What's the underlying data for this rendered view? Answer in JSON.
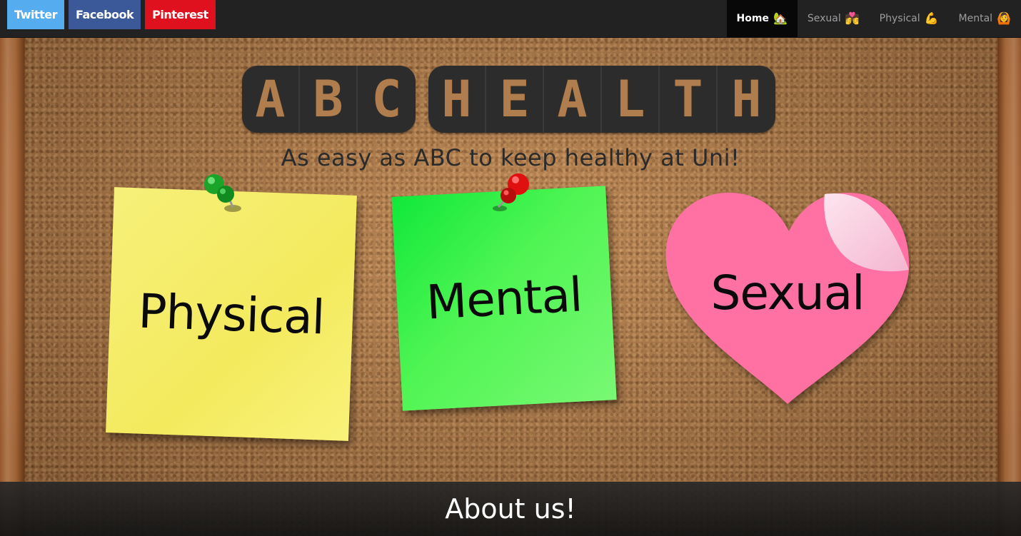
{
  "social": {
    "twitter": {
      "label": "Twitter",
      "color": "#55acee"
    },
    "facebook": {
      "label": "Facebook",
      "color": "#3b5998"
    },
    "pinterest": {
      "label": "Pinterest",
      "color": "#e0111f"
    }
  },
  "nav": {
    "items": [
      {
        "label": "Home",
        "emoji": "🏡",
        "active": true
      },
      {
        "label": "Sexual",
        "emoji": "💏",
        "active": false
      },
      {
        "label": "Physical",
        "emoji": "💪",
        "active": false
      },
      {
        "label": "Mental",
        "emoji": "🙆",
        "active": false
      }
    ]
  },
  "hero": {
    "title_words": [
      "ABC",
      "HEALTH"
    ],
    "tagline": "As easy as ABC to keep healthy at Uni!"
  },
  "notes": {
    "physical": {
      "label": "Physical",
      "color": "#f4ea5e"
    },
    "mental": {
      "label": "Mental",
      "color": "#4ff553"
    },
    "sexual": {
      "label": "Sexual",
      "color": "#ff6fa3"
    }
  },
  "pins": {
    "green": "#1aa52a",
    "red": "#e01010"
  },
  "footer": {
    "about_label": "About us!"
  }
}
